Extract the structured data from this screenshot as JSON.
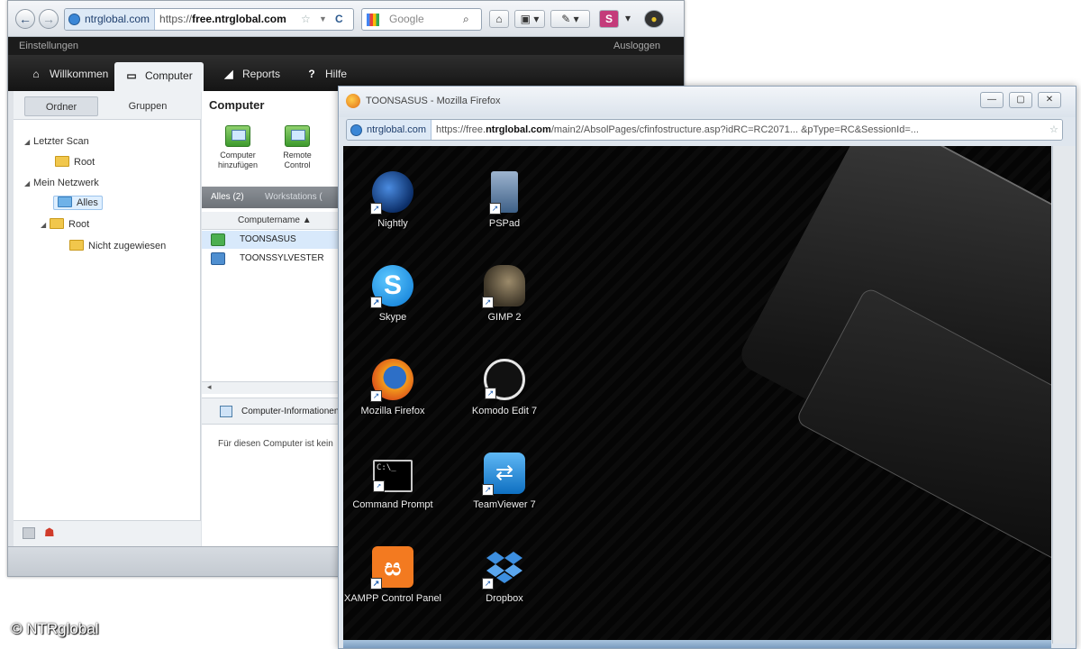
{
  "back_window": {
    "nav": {
      "domain": "ntrglobal.com",
      "url_prefix": "https://",
      "url_bold": "free.ntrglobal.com",
      "search_placeholder": "Google"
    },
    "topbar": {
      "left": "Einstellungen",
      "right": "Ausloggen"
    },
    "tabs": [
      {
        "label": "Willkommen",
        "icon": "home-icon"
      },
      {
        "label": "Computer",
        "icon": "monitor-icon",
        "active": true
      },
      {
        "label": "Reports",
        "icon": "chart-icon"
      },
      {
        "label": "Hilfe",
        "icon": "help-icon"
      }
    ],
    "sidebar": {
      "tabs": [
        "Ordner",
        "Gruppen"
      ],
      "tree": [
        "Letzter Scan",
        "Root",
        "Mein Netzwerk",
        "Alles",
        "Root",
        "Nicht zugewiesen"
      ]
    },
    "content": {
      "title": "Computer",
      "btn_add_1": "Computer",
      "btn_add_2": "hinzufügen",
      "btn_remote_1": "Remote",
      "btn_remote_2": "Control",
      "filter_all": "Alles (2)",
      "filter_ws": "Workstations (",
      "col_name": "Computername ▲",
      "rows": [
        "TOONSASUS",
        "TOONSSYLVESTER"
      ],
      "info_title": "Computer-Informationen",
      "info_text": "Für diesen Computer ist kein"
    }
  },
  "front_window": {
    "title": "TOONSASUS - Mozilla Firefox",
    "url_domain": "ntrglobal.com",
    "url_prefix": "https://free.",
    "url_bold": "ntrglobal.com",
    "url_rest": "/main2/AbsolPages/cfinfostructure.asp?idRC=RC2071... &pType=RC&SessionId=...",
    "desktop_icons": [
      {
        "label": "Nightly",
        "icon": "nightly-icon"
      },
      {
        "label": "PSPad",
        "icon": "pspad-icon"
      },
      {
        "label": "Skype",
        "icon": "skype-icon"
      },
      {
        "label": "GIMP 2",
        "icon": "gimp-icon"
      },
      {
        "label": "Mozilla Firefox",
        "icon": "firefox-icon"
      },
      {
        "label": "Komodo Edit 7",
        "icon": "komodo-icon"
      },
      {
        "label": "Command Prompt",
        "icon": "cmd-icon"
      },
      {
        "label": "TeamViewer 7",
        "icon": "teamviewer-icon"
      },
      {
        "label": "XAMPP Control Panel",
        "icon": "xampp-icon"
      },
      {
        "label": "Dropbox",
        "icon": "dropbox-icon"
      }
    ]
  },
  "copyright": "© NTRglobal"
}
